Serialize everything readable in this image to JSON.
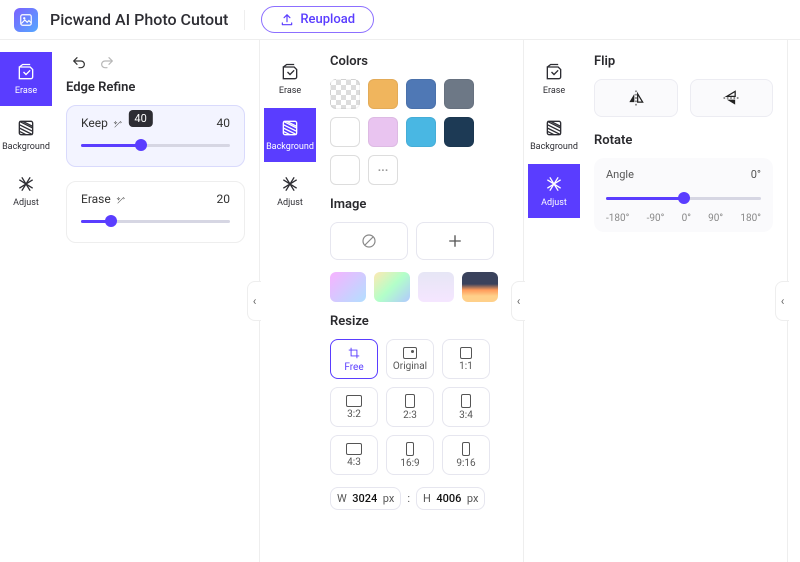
{
  "header": {
    "title": "Picwand AI Photo Cutout",
    "reupload": "Reupload"
  },
  "tabs": {
    "erase": "Erase",
    "background": "Background",
    "adjust": "Adjust"
  },
  "erase_panel": {
    "heading": "Edge Refine",
    "keep": {
      "label": "Keep",
      "value": 40,
      "tooltip": "40",
      "percent": 40
    },
    "erase": {
      "label": "Erase",
      "value": 20,
      "percent": 20
    }
  },
  "background_panel": {
    "colors_heading": "Colors",
    "colors": [
      "transparent",
      "#f0b55d",
      "#4f78b5",
      "#6d7886",
      "#ffffff",
      "#e9c4f0",
      "#49b7e3",
      "#1d3a55"
    ],
    "more": "···",
    "image_heading": "Image",
    "resize_heading": "Resize",
    "resize_options": [
      {
        "key": "free",
        "label": "Free"
      },
      {
        "key": "original",
        "label": "Original"
      },
      {
        "key": "1_1",
        "label": "1:1"
      },
      {
        "key": "3_2",
        "label": "3:2"
      },
      {
        "key": "2_3",
        "label": "2:3"
      },
      {
        "key": "3_4",
        "label": "3:4"
      },
      {
        "key": "4_3",
        "label": "4:3"
      },
      {
        "key": "16_9",
        "label": "16:9"
      },
      {
        "key": "9_16",
        "label": "9:16"
      }
    ],
    "active_resize": "free",
    "dim": {
      "w_label": "W",
      "w": "3024",
      "h_label": "H",
      "h": "4006",
      "unit": "px",
      "sep": ":"
    }
  },
  "adjust_panel": {
    "flip_heading": "Flip",
    "rotate_heading": "Rotate",
    "angle_label": "Angle",
    "angle_value": "0°",
    "angle_percent": 50,
    "ticks": [
      "-180°",
      "-90°",
      "0°",
      "90°",
      "180°"
    ]
  }
}
